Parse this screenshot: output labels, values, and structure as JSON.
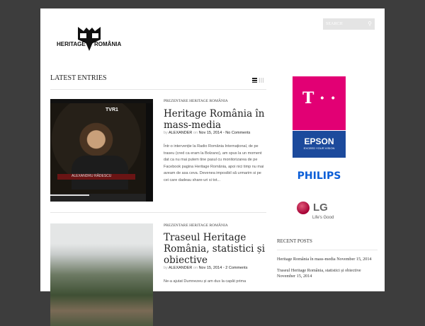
{
  "header": {
    "logo_text_left": "HERITAGE",
    "logo_text_right": "ROMÂNIA",
    "search_placeholder": "SEARCH"
  },
  "main": {
    "heading": "LATEST ENTRIES",
    "posts": [
      {
        "category": "PREZENTARE HERITAGE ROMÂNIA",
        "title": "Heritage România în mass-media",
        "by": "by",
        "author": "ALEXANDER",
        "on": "on",
        "date": "Nov 15, 2014",
        "comments": "No Comments",
        "excerpt": "Într-o intervenție la Radio România Internațional, de pe traseu (cred ca eram la Bolzano), am spus la un moment dat ca nu mai putem tine pasul cu monitorizarea de pe Facebook pagina Heritage România, apoi nici timp nu mai aveam de asa ceva. Devenea imposibil să urmarim si pe cei care dadeau share-uri si tot...",
        "video_caption": "ALEXANDRU RĂDESCU",
        "video_channel": "TVR1"
      },
      {
        "category": "PREZENTARE HERITAGE ROMÂNIA",
        "title": "Traseul Heritage România, statistici și obiective",
        "by": "by",
        "author": "ALEXANDER",
        "on": "on",
        "date": "Nov 15, 2014",
        "comments": "2 Comments",
        "excerpt": "Ne-a ajutat Dumnezeu și am dus la capăt prima"
      }
    ]
  },
  "sidebar": {
    "sponsors": {
      "tmobile": "T · ·",
      "epson": "EPSON",
      "epson_tag": "EXCEED YOUR VISION",
      "philips": "PHILIPS",
      "lg": "LG",
      "lg_tag": "Life's Good"
    },
    "recent_heading": "RECENT POSTS",
    "recent": [
      {
        "title": "Heritage România în mass-media",
        "date": "November 15, 2014"
      },
      {
        "title": "Traseul Heritage România, statistici și obiective",
        "date": "November 15, 2014"
      }
    ]
  },
  "colors": {
    "tmobile": "#e20074",
    "epson": "#1c4a9c",
    "philips": "#0b5ed7",
    "lg": "#a50034"
  }
}
